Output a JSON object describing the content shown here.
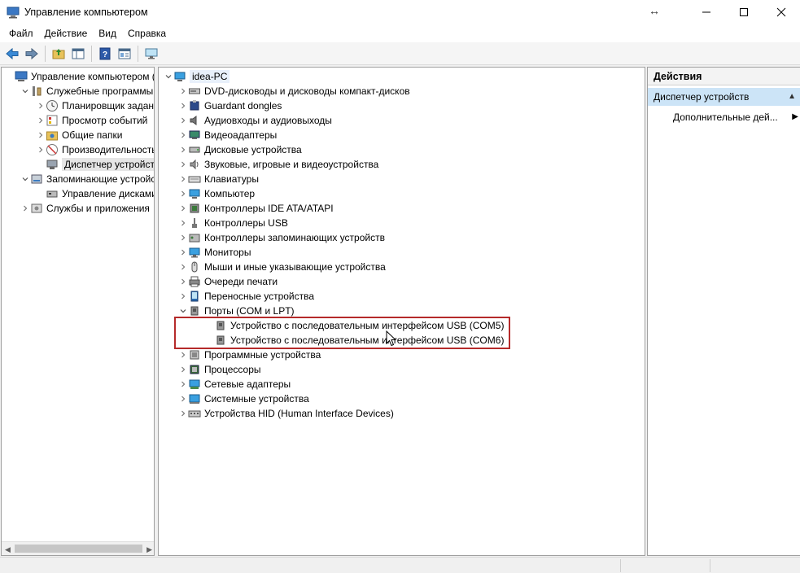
{
  "window": {
    "title": "Управление компьютером",
    "resize_glyph": "↔"
  },
  "menu": [
    "Файл",
    "Действие",
    "Вид",
    "Справка"
  ],
  "toolbar": {
    "buttons": [
      "back-arrow-icon",
      "forward-arrow-icon",
      "folder-up-icon",
      "show-hide-tree-icon",
      "help-icon",
      "properties-icon",
      "monitor-icon"
    ]
  },
  "left_tree": {
    "items": [
      {
        "label": "Управление компьютером (л",
        "icon": "computer-management-icon",
        "level": 0,
        "expander": "none"
      },
      {
        "label": "Служебные программы",
        "icon": "tools-icon",
        "level": 1,
        "expander": "expanded"
      },
      {
        "label": "Планировщик заданий",
        "icon": "clock-icon",
        "level": 2,
        "expander": "collapsed"
      },
      {
        "label": "Просмотр событий",
        "icon": "event-viewer-icon",
        "level": 2,
        "expander": "collapsed"
      },
      {
        "label": "Общие папки",
        "icon": "shared-folder-icon",
        "level": 2,
        "expander": "collapsed"
      },
      {
        "label": "Производительность",
        "icon": "performance-icon",
        "level": 2,
        "expander": "collapsed"
      },
      {
        "label": "Диспетчер устройств",
        "icon": "device-manager-icon",
        "level": 2,
        "expander": "none",
        "selected": true
      },
      {
        "label": "Запоминающие устройст",
        "icon": "storage-icon",
        "level": 1,
        "expander": "expanded"
      },
      {
        "label": "Управление дисками",
        "icon": "disk-management-icon",
        "level": 2,
        "expander": "none"
      },
      {
        "label": "Службы и приложения",
        "icon": "services-icon",
        "level": 1,
        "expander": "collapsed"
      }
    ]
  },
  "device_tree": {
    "root": "idea-PC",
    "categories": [
      {
        "label": "DVD-дисководы и дисководы компакт-дисков",
        "icon": "dvd-drive-icon"
      },
      {
        "label": "Guardant dongles",
        "icon": "dongle-icon"
      },
      {
        "label": "Аудиовходы и аудиовыходы",
        "icon": "speaker-icon"
      },
      {
        "label": "Видеоадаптеры",
        "icon": "display-adapter-icon"
      },
      {
        "label": "Дисковые устройства",
        "icon": "disk-drive-icon"
      },
      {
        "label": "Звуковые, игровые и видеоустройства",
        "icon": "sound-icon"
      },
      {
        "label": "Клавиатуры",
        "icon": "keyboard-icon"
      },
      {
        "label": "Компьютер",
        "icon": "computer-icon"
      },
      {
        "label": "Контроллеры IDE ATA/ATAPI",
        "icon": "ide-controller-icon"
      },
      {
        "label": "Контроллеры USB",
        "icon": "usb-icon"
      },
      {
        "label": "Контроллеры запоминающих устройств",
        "icon": "storage-controller-icon"
      },
      {
        "label": "Мониторы",
        "icon": "monitor-icon"
      },
      {
        "label": "Мыши и иные указывающие устройства",
        "icon": "mouse-icon"
      },
      {
        "label": "Очереди печати",
        "icon": "printer-icon"
      },
      {
        "label": "Переносные устройства",
        "icon": "portable-device-icon"
      },
      {
        "label": "Порты (COM и LPT)",
        "icon": "port-icon",
        "expanded": true,
        "children": [
          {
            "label": "Устройство с последовательным интерфейсом USB (COM5)",
            "icon": "serial-port-icon"
          },
          {
            "label": "Устройство с последовательным интерфейсом USB (COM6)",
            "icon": "serial-port-icon"
          }
        ]
      },
      {
        "label": "Программные устройства",
        "icon": "software-device-icon"
      },
      {
        "label": "Процессоры",
        "icon": "processor-icon"
      },
      {
        "label": "Сетевые адаптеры",
        "icon": "network-adapter-icon"
      },
      {
        "label": "Системные устройства",
        "icon": "system-device-icon"
      },
      {
        "label": "Устройства HID (Human Interface Devices)",
        "icon": "hid-icon"
      }
    ]
  },
  "actions": {
    "header": "Действия",
    "section": "Диспетчер устройств",
    "items": [
      "Дополнительные дей..."
    ]
  },
  "colors": {
    "highlight_box": "#b52a2a",
    "selection": "#cce4f7"
  }
}
